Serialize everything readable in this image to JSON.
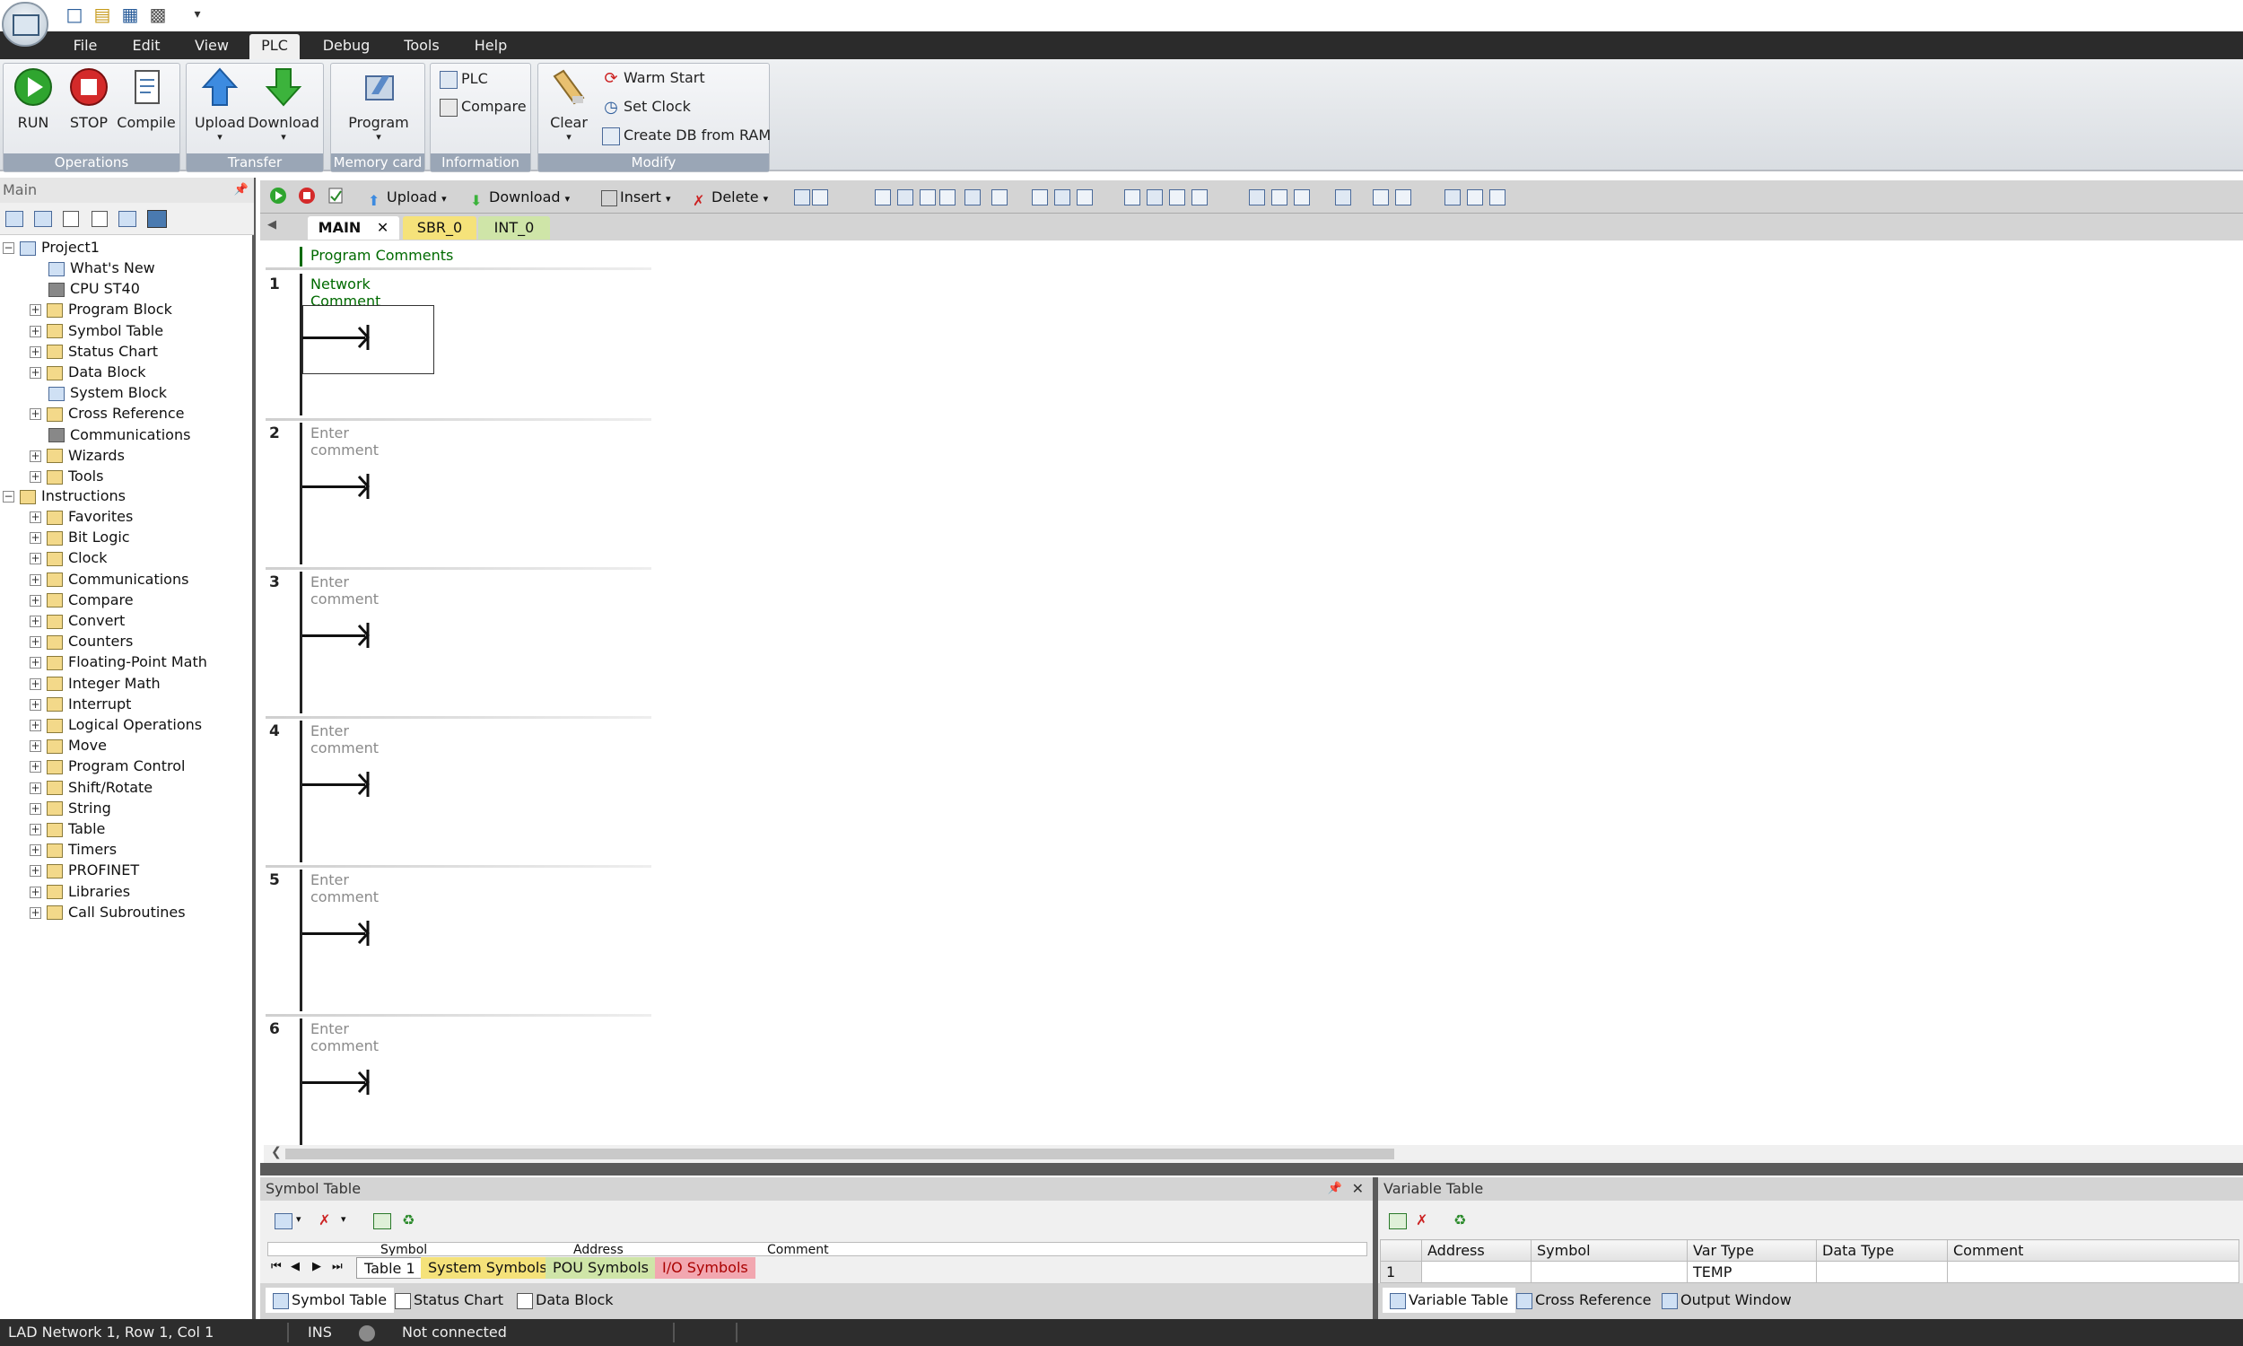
{
  "menu": {
    "file": "File",
    "edit": "Edit",
    "view": "View",
    "plc": "PLC",
    "debug": "Debug",
    "tools": "Tools",
    "help": "Help"
  },
  "ribbon": {
    "operations": {
      "caption": "Operations",
      "run": "RUN",
      "stop": "STOP",
      "compile": "Compile"
    },
    "transfer": {
      "caption": "Transfer",
      "upload": "Upload",
      "download": "Download"
    },
    "memory_card": {
      "caption": "Memory card",
      "program": "Program"
    },
    "information": {
      "caption": "Information",
      "plc": "PLC",
      "compare": "Compare"
    },
    "modify": {
      "caption": "Modify",
      "clear": "Clear",
      "warm_start": "Warm Start",
      "set_clock": "Set Clock",
      "create_db": "Create DB from RAM"
    }
  },
  "left_panel": {
    "title": "Main",
    "project": "Project1",
    "project_items": [
      "What's New",
      "CPU ST40",
      "Program Block",
      "Symbol Table",
      "Status Chart",
      "Data Block",
      "System Block",
      "Cross Reference",
      "Communications",
      "Wizards",
      "Tools"
    ],
    "instructions": "Instructions",
    "instruction_items": [
      "Favorites",
      "Bit Logic",
      "Clock",
      "Communications",
      "Compare",
      "Convert",
      "Counters",
      "Floating-Point Math",
      "Integer Math",
      "Interrupt",
      "Logical Operations",
      "Move",
      "Program Control",
      "Shift/Rotate",
      "String",
      "Table",
      "Timers",
      "PROFINET",
      "Libraries",
      "Call Subroutines"
    ]
  },
  "editor_toolbar": {
    "upload": "Upload",
    "download": "Download",
    "insert": "Insert",
    "delete": "Delete"
  },
  "pou_tabs": {
    "main": "MAIN",
    "sbr": "SBR_0",
    "int": "INT_0"
  },
  "ladder": {
    "program_comments": "Program Comments",
    "networks": [
      {
        "num": "1",
        "comment": "Network Comment"
      },
      {
        "num": "2",
        "comment": "Enter comment"
      },
      {
        "num": "3",
        "comment": "Enter comment"
      },
      {
        "num": "4",
        "comment": "Enter comment"
      },
      {
        "num": "5",
        "comment": "Enter comment"
      },
      {
        "num": "6",
        "comment": "Enter comment"
      }
    ]
  },
  "symbol_table": {
    "title": "Symbol Table",
    "columns": [
      "Symbol",
      "Address",
      "Comment"
    ],
    "sheet_tabs": [
      "Table 1",
      "System Symbols",
      "POU Symbols",
      "I/O Symbols"
    ]
  },
  "variable_table": {
    "title": "Variable Table",
    "columns": [
      "Address",
      "Symbol",
      "Var Type",
      "Data Type",
      "Comment"
    ],
    "row": {
      "num": "1",
      "var_type": "TEMP"
    }
  },
  "bottom_tabs_left": [
    "Symbol Table",
    "Status Chart",
    "Data Block"
  ],
  "bottom_tabs_right": [
    "Variable Table",
    "Cross Reference",
    "Output Window"
  ],
  "status": {
    "position": "LAD Network 1, Row 1, Col 1",
    "mode": "INS",
    "connection": "Not connected"
  },
  "colors": {
    "accent": "#2b2b2b",
    "comment_green": "#006a00",
    "tab_yellow": "#f5e27a",
    "tab_green": "#cfe5a8",
    "tab_pink": "#f2a7b0"
  }
}
